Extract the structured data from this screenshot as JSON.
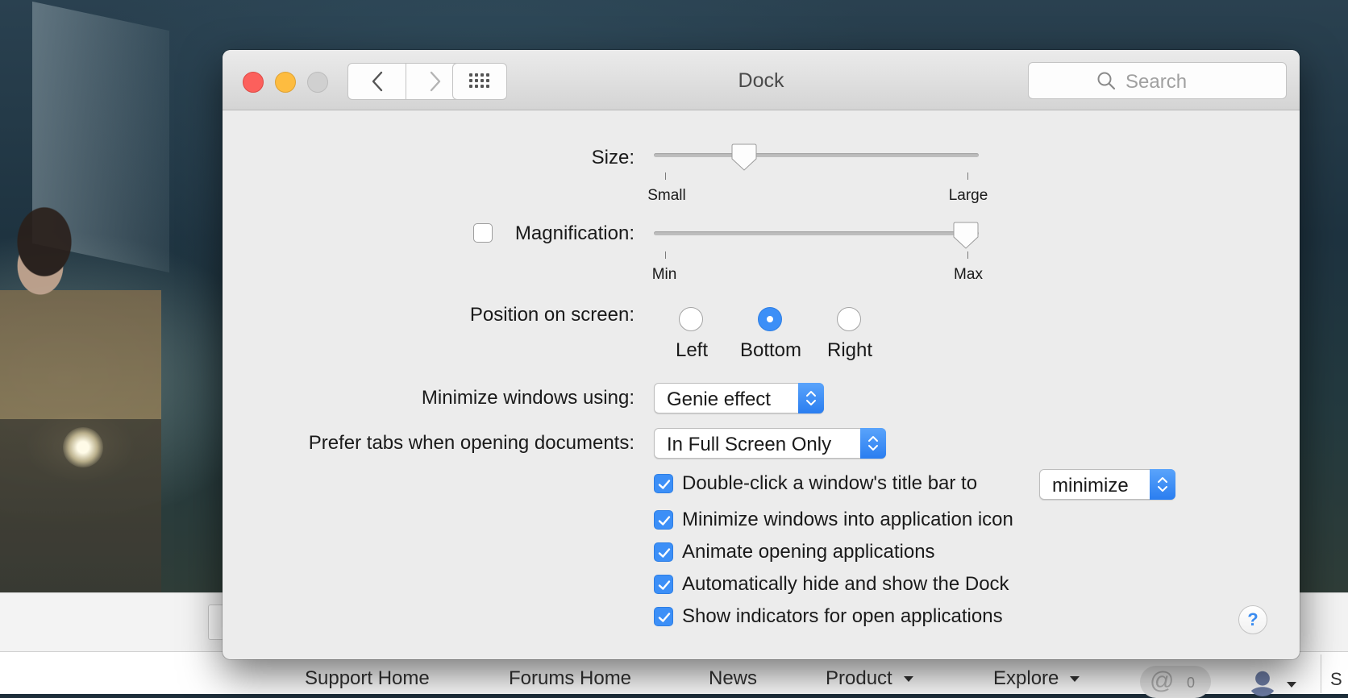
{
  "window": {
    "title": "Dock",
    "search_placeholder": "Search"
  },
  "size": {
    "label": "Size:",
    "min_label": "Small",
    "max_label": "Large",
    "value_fraction": 0.26
  },
  "magnification": {
    "label": "Magnification:",
    "enabled": false,
    "min_label": "Min",
    "max_label": "Max",
    "value_fraction": 1.0
  },
  "position": {
    "label": "Position on screen:",
    "options": [
      "Left",
      "Bottom",
      "Right"
    ],
    "selected": "Bottom"
  },
  "minimize_using": {
    "label": "Minimize windows using:",
    "value": "Genie effect"
  },
  "prefer_tabs": {
    "label": "Prefer tabs when opening documents:",
    "value": "In Full Screen Only"
  },
  "double_click": {
    "label": "Double-click a window's title bar to",
    "checked": true,
    "value": "minimize"
  },
  "checkboxes": [
    {
      "label": "Minimize windows into application icon",
      "checked": true
    },
    {
      "label": "Animate opening applications",
      "checked": true
    },
    {
      "label": "Automatically hide and show the Dock",
      "checked": true
    },
    {
      "label": "Show indicators for open applications",
      "checked": true
    }
  ],
  "help": "?",
  "web_nav": {
    "items": [
      "Support Home",
      "Forums Home",
      "News",
      "Product",
      "Explore"
    ],
    "mentions_count": "0",
    "trailing_text": "S"
  },
  "colors": {
    "accent": "#3c8ff7",
    "close": "#fc605c",
    "minimize": "#fdbc40"
  }
}
